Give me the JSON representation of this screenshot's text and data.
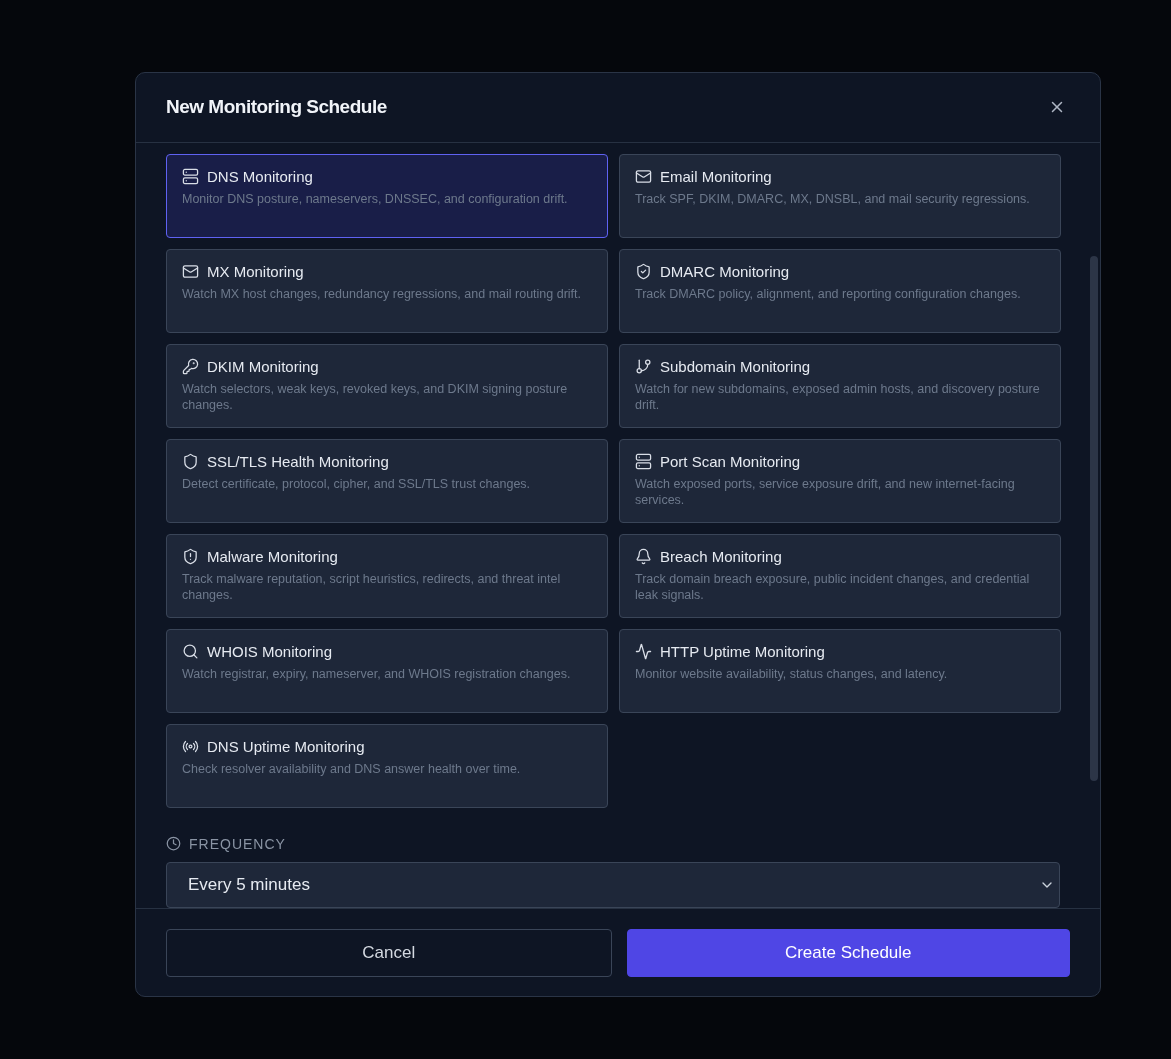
{
  "dialog": {
    "title": "New Monitoring Schedule",
    "options": [
      {
        "title": "DNS Monitoring",
        "description": "Monitor DNS posture, nameservers, DNSSEC, and configuration drift.",
        "selected": true
      },
      {
        "title": "Email Monitoring",
        "description": "Track SPF, DKIM, DMARC, MX, DNSBL, and mail security regressions.",
        "selected": false
      },
      {
        "title": "MX Monitoring",
        "description": "Watch MX host changes, redundancy regressions, and mail routing drift.",
        "selected": false
      },
      {
        "title": "DMARC Monitoring",
        "description": "Track DMARC policy, alignment, and reporting configuration changes.",
        "selected": false
      },
      {
        "title": "DKIM Monitoring",
        "description": "Watch selectors, weak keys, revoked keys, and DKIM signing posture changes.",
        "selected": false
      },
      {
        "title": "Subdomain Monitoring",
        "description": "Watch for new subdomains, exposed admin hosts, and discovery posture drift.",
        "selected": false
      },
      {
        "title": "SSL/TLS Health Monitoring",
        "description": "Detect certificate, protocol, cipher, and SSL/TLS trust changes.",
        "selected": false
      },
      {
        "title": "Port Scan Monitoring",
        "description": "Watch exposed ports, service exposure drift, and new internet-facing services.",
        "selected": false
      },
      {
        "title": "Malware Monitoring",
        "description": "Track malware reputation, script heuristics, redirects, and threat intel changes.",
        "selected": false
      },
      {
        "title": "Breach Monitoring",
        "description": "Track domain breach exposure, public incident changes, and credential leak signals.",
        "selected": false
      },
      {
        "title": "WHOIS Monitoring",
        "description": "Watch registrar, expiry, nameserver, and WHOIS registration changes.",
        "selected": false
      },
      {
        "title": "HTTP Uptime Monitoring",
        "description": "Monitor website availability, status changes, and latency.",
        "selected": false
      },
      {
        "title": "DNS Uptime Monitoring",
        "description": "Check resolver availability and DNS answer health over time.",
        "selected": false
      }
    ],
    "frequency": {
      "label": "FREQUENCY",
      "value": "Every 5 minutes"
    },
    "buttons": {
      "cancel": "Cancel",
      "create": "Create Schedule"
    }
  }
}
